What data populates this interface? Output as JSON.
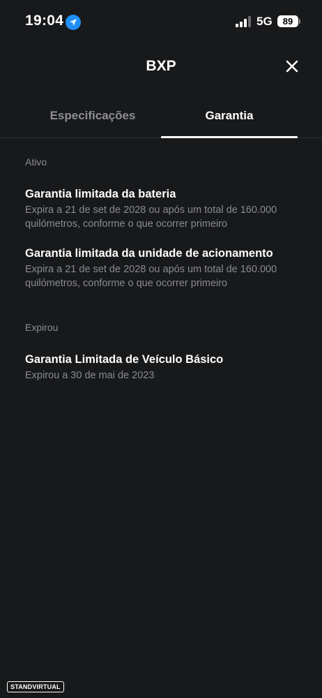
{
  "status_bar": {
    "time": "19:04",
    "network": "5G",
    "battery": "89"
  },
  "header": {
    "title": "BXP"
  },
  "tabs": [
    {
      "label": "Especificações",
      "active": false
    },
    {
      "label": "Garantia",
      "active": true
    }
  ],
  "sections": [
    {
      "label": "Ativo",
      "items": [
        {
          "title": "Garantia limitada da bateria",
          "line1": "Expira a 21 de set de 2028 ou após um total de 160.000",
          "line2": "quilómetros, conforme o que ocorrer primeiro"
        },
        {
          "title": "Garantia limitada da unidade de acionamento",
          "line1": "Expira a 21 de set de 2028 ou após um total de 160.000",
          "line2": "quilómetros, conforme o que ocorrer primeiro"
        }
      ]
    },
    {
      "label": "Expirou",
      "items": [
        {
          "title": "Garantia Limitada de Veículo Básico",
          "line1": "Expirou a 30 de mai de 2023"
        }
      ]
    }
  ],
  "watermark": "STANDVIRTUAL",
  "colors": {
    "background": "#18191b",
    "text_primary": "#ffffff",
    "text_secondary": "#8a8b8f",
    "location_accent": "#1e8ff7"
  }
}
